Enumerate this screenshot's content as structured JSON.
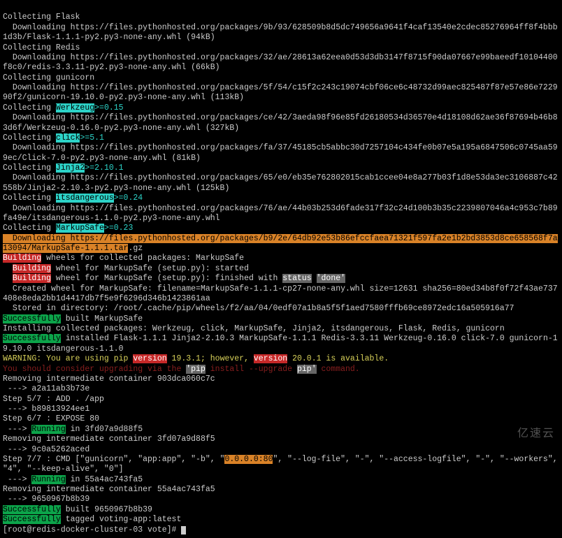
{
  "flask_collect": "Collecting Flask",
  "flask_dl": "  Downloading https://files.pythonhosted.org/packages/9b/93/628509b8d5dc749656a9641f4caf13540e2cdec85276964ff8f4bbb1d3b/Flask-1.1.1-py2.py3-none-any.whl (94kB)",
  "redis_collect": "Collecting Redis",
  "redis_dl": "  Downloading https://files.pythonhosted.org/packages/32/ae/28613a62eea0d53d3db3147f8715f90da07667e99baeedf10104400f8c0/redis-3.3.11-py2.py3-none-any.whl (66kB)",
  "gunicorn_collect": "Collecting gunicorn",
  "gunicorn_dl": "  Downloading https://files.pythonhosted.org/packages/5f/54/c15f2c243c19074cbf06ce6c48732d99aec825487f87e57e86e722990f2/gunicorn-19.10.0-py2.py3-none-any.whl (113kB)",
  "werk_c1": "Collecting ",
  "werk_c2": "Werkzeug",
  "werk_c3": ">=0.15",
  "werk_dl": "  Downloading https://files.pythonhosted.org/packages/ce/42/3aeda98f96e85fd26180534d36570e4d18108d62ae36f87694b46b83d6f/Werkzeug-0.16.0-py2.py3-none-any.whl (327kB)",
  "click_c1": "Collecting ",
  "click_c2": "click",
  "click_c3": ">=5.1",
  "click_dl": "  Downloading https://files.pythonhosted.org/packages/fa/37/45185cb5abbc30d7257104c434fe0b07e5a195a6847506c0745aa599ec/Click-7.0-py2.py3-none-any.whl (81kB)",
  "jinja_c1": "Collecting ",
  "jinja_c2": "Jinja2",
  "jinja_c3": ">=2.10.1",
  "jinja_dl": "  Downloading https://files.pythonhosted.org/packages/65/e0/eb35e762802015cab1ccee04e8a277b03f1d8e53da3ec3106887c42558b/Jinja2-2.10.3-py2.py3-none-any.whl (125kB)",
  "its_c1": "Collecting ",
  "its_c2": "itsdangerous",
  "its_c3": ">=0.24",
  "its_dl": "  Downloading https://files.pythonhosted.org/packages/76/ae/44b03b253d6fade317f32c24d100b3b35c2239807046a4c953c7b89fa49e/itsdangerous-1.1.0-py2.py3-none-any.whl",
  "mark_c1": "Collecting ",
  "mark_c2": "MarkupSafe",
  "mark_c3": ">=0.23",
  "mark_dl1": "  Downloading https://files.pythonhosted.org/packages/b9/2e/64db92e53b86efccfaea71321f597fa2e1b2bd3853d8ce658568f7a13094/MarkupSafe-1.1.1.tar",
  "mark_dl2": ".gz",
  "build_lead": "Building",
  "build_tail": " wheels for collected packages: MarkupSafe",
  "bstart_lead": "  ",
  "bstart_hl": "Building",
  "bstart_tail": " wheel for MarkupSafe (setup.py): started",
  "bfin_lead": "  ",
  "bfin_hl": "Building",
  "bfin_tail1": " wheel for MarkupSafe (setup.py): finished with ",
  "bfin_status": "status",
  "bfin_sp": " ",
  "bfin_done": "'done'",
  "created_wheel": "  Created wheel for MarkupSafe: filename=MarkupSafe-1.1.1-cp27-none-any.whl size=12631 sha256=80ed34b8f0f72f43ae737408e8eda2bb1d4417db7f5e9f6296d346b1423861aa",
  "stored": "  Stored in directory: /root/.cache/pip/wheels/f2/aa/04/0edf07a1b8a5f5f1aed7580fffb69ce8972edc16a505916a77",
  "succ1": "Successfully",
  "succ1_tail": " built MarkupSafe",
  "installing": "Installing collected packages: Werkzeug, click, MarkupSafe, Jinja2, itsdangerous, Flask, Redis, gunicorn",
  "succ2": "Successfully",
  "succ2_tail": " installed Flask-1.1.1 Jinja2-2.10.3 MarkupSafe-1.1.1 Redis-3.3.11 Werkzeug-0.16.0 click-7.0 gunicorn-19.10.0 itsdangerous-1.1.0",
  "warn_a": "WARNING: You are using pip ",
  "warn_b": "version",
  "warn_c": " 19.3.1; however, ",
  "warn_d": "version",
  "warn_e": " 20.0.1 is available.",
  "warn2_a": "You should consider upgrading via the ",
  "warn2_b": "'pip",
  "warn2_c": " install --upgrade ",
  "warn2_d": "pip'",
  "warn2_e": " command.",
  "rm1": "Removing intermediate container 903dca060c7c",
  "arrow1": " ---> a2a11ab3b73e",
  "step5": "Step 5/7 : ADD . /app",
  "arrow2": " ---> b89813924ee1",
  "step6": "Step 6/7 : EXPOSE 80",
  "run1_a": " ---> ",
  "run1_b": "Running",
  "run1_c": " in 3fd07a9d88f5",
  "rm2": "Removing intermediate container 3fd07a9d88f5",
  "arrow3": " ---> 9c0a5262aced",
  "step7a": "Step 7/7 : CMD [\"gunicorn\", \"app:app\", \"-b\", \"",
  "step7b": "0.0.0.0:80",
  "step7c": "\", \"--log-file\", \"-\", \"--access-logfile\", \"-\", \"--workers\", \"4\", \"--keep-alive\", \"0\"]",
  "run2_a": " ---> ",
  "run2_b": "Running",
  "run2_c": " in 55a4ac743fa5",
  "rm3": "Removing intermediate container 55a4ac743fa5",
  "arrow4": " ---> 9650967b8b39",
  "succ3": "Successfully",
  "succ3_tail": " built 9650967b8b39",
  "succ4": "Successfully",
  "succ4_tail": " tagged voting-app:latest",
  "prompt": "[root@redis-docker-cluster-03 vote]# ",
  "logo": "亿速云"
}
